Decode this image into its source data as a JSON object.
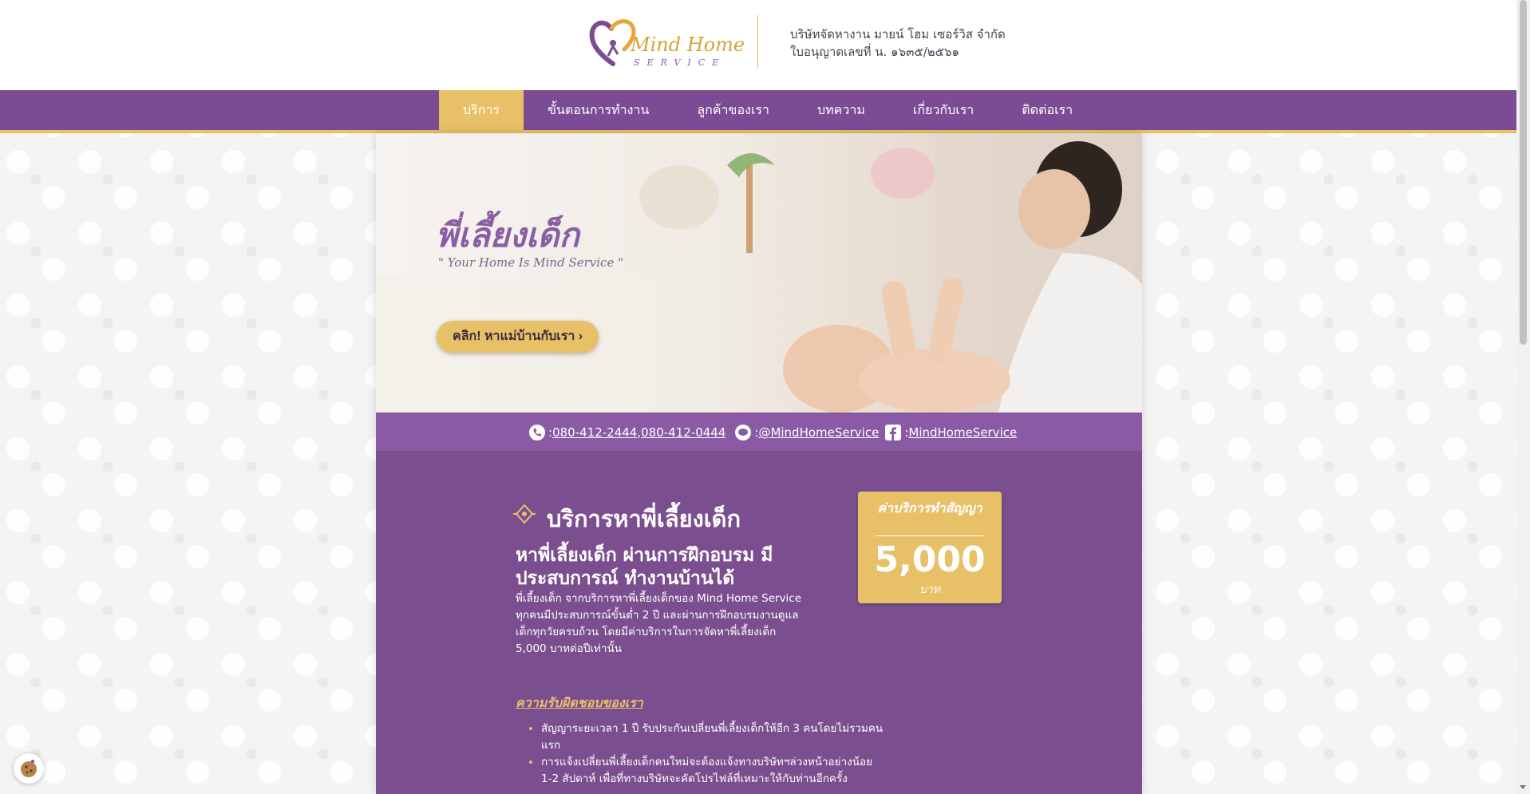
{
  "brand": {
    "logo_main": "Mind Home",
    "logo_service": "SERVICE",
    "company_name": "บริษัทจัดหางาน มายน์ โฮม เซอร์วิส จำกัด",
    "license": "ใบอนุญาตเลขที่ น. ๑๖๓๕/๒๕๖๑"
  },
  "nav": {
    "items": [
      {
        "label": "บริการ"
      },
      {
        "label": "ขั้นตอนการทำงาน"
      },
      {
        "label": "ลูกค้าของเรา"
      },
      {
        "label": "บทความ"
      },
      {
        "label": "เกี่ยวกับเรา"
      },
      {
        "label": "ติดต่อเรา"
      }
    ]
  },
  "hero": {
    "title": "พี่เลี้ยงเด็ก",
    "subtitle": "\" Your Home Is Mind Service \"",
    "cta_label": "คลิก! หาแม่บ้านกับเรา",
    "cta_icon": "chevron-right-icon"
  },
  "contact": {
    "phone_sep": " : ",
    "phone1": "080-412-2444",
    "comma": " , ",
    "phone2": "080-412-0444",
    "line_sep": " : ",
    "line_id": "@MindHomeService",
    "fb_sep": " : ",
    "facebook": "MindHomeService"
  },
  "service": {
    "title": "บริการหาพี่เลี้ยงเด็ก",
    "subtitle": "หาพี่เลี้ยงเด็ก ผ่านการฝึกอบรม มีประสบการณ์ ทำงานบ้านได้",
    "description": "พี่เลี้ยงเด็ก จากบริการหาพี่เลี้ยงเด็กของ Mind Home Service ทุกคนมีประสบการณ์ขั้นต่ำ 2 ปี และผ่านการฝึกอบรมงานดูแลเด็กทุกวัยครบถ้วน โดยมีค่าบริการในการจัดหาพี่เลี้ยงเด็ก 5,000 บาทต่อปีเท่านั้น",
    "responsibility_title": "ความรับผิดชอบของเรา",
    "responsibilities": [
      "สัญญาระยะเวลา 1 ปี รับประกันเปลี่ยนพี่เลี้ยงเด็กให้อีก 3 คนโดยไม่รวมคนแรก",
      "การแจ้งเปลี่ยนพี่เลี้ยงเด็กคนใหม่จะต้องแจ้งทางบริษัทฯล่วงหน้าอย่างน้อย 1-2 สัปดาห์ เพื่อที่ทางบริษัทจะคัดโปรไฟล์ที่เหมาะให้กับท่านอีกครั้ง"
    ]
  },
  "price": {
    "label": "ค่าบริการทำสัญญา",
    "value": "5,000",
    "unit": "บาท"
  },
  "colors": {
    "purple": "#7b4c93",
    "gold": "#e8c068"
  }
}
